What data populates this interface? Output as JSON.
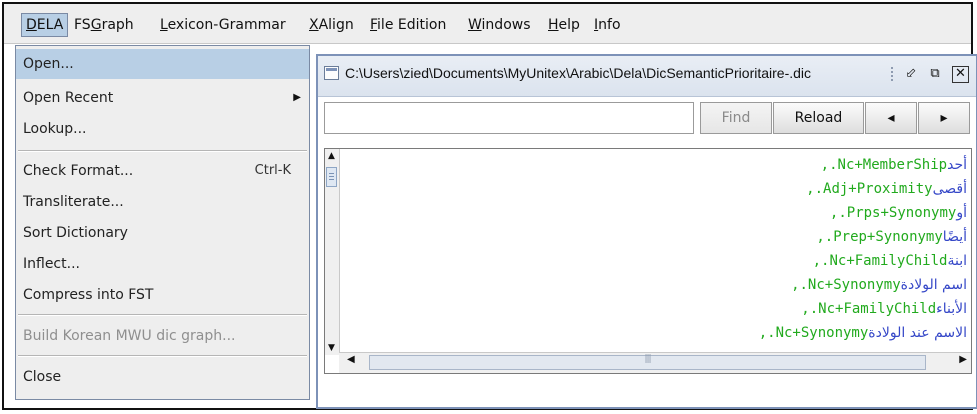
{
  "menubar": {
    "items": [
      {
        "pre": "",
        "mn": "D",
        "post": "ELA"
      },
      {
        "pre": "FS",
        "mn": "G",
        "post": "raph"
      },
      {
        "pre": "",
        "mn": "L",
        "post": "exicon-Grammar"
      },
      {
        "pre": "",
        "mn": "X",
        "post": "Align"
      },
      {
        "pre": "",
        "mn": "F",
        "post": "ile Edition"
      },
      {
        "pre": "",
        "mn": "W",
        "post": "indows"
      },
      {
        "pre": "",
        "mn": "H",
        "post": "elp"
      },
      {
        "pre": "",
        "mn": "I",
        "post": "nfo"
      }
    ]
  },
  "dropdown": {
    "open": "Open...",
    "open_recent": "Open Recent",
    "lookup": "Lookup...",
    "check_format": "Check Format...",
    "check_format_shortcut": "Ctrl-K",
    "transliterate": "Transliterate...",
    "sort_dictionary": "Sort Dictionary",
    "inflect": "Inflect...",
    "compress": "Compress into FST",
    "build_korean": "Build Korean MWU dic graph...",
    "close": "Close"
  },
  "window": {
    "title": "C:\\Users\\zied\\Documents\\MyUnitex\\Arabic\\Dela\\DicSemanticPrioritaire-.dic",
    "search_value": "",
    "find_label": "Find",
    "reload_label": "Reload",
    "prev_label": "◂",
    "next_label": "▸"
  },
  "dictionary_lines": [
    {
      "ar": "أحد",
      "code": ",.Nc+MemberShip"
    },
    {
      "ar": "أقصى",
      "code": ",.Adj+Proximity"
    },
    {
      "ar": "أو",
      "code": ",.Prps+Synonymy"
    },
    {
      "ar": "أيضًا",
      "code": ",.Prep+Synonymy"
    },
    {
      "ar": "ابنة",
      "code": ",.Nc+FamilyChild"
    },
    {
      "ar": "اسم الولادة",
      "code": ",.Nc+Synonymy"
    },
    {
      "ar": "الأبناء",
      "code": ",.Nc+FamilyChild"
    },
    {
      "ar": "الاسم عند الولادة",
      "code": ",.Nc+Synonymy"
    }
  ],
  "colors": {
    "arabic_text": "#3648c8",
    "code_text": "#22aa1e",
    "menu_highlight": "#b8cfe5"
  }
}
